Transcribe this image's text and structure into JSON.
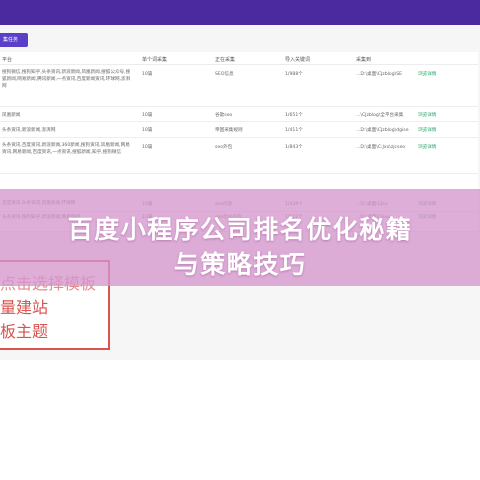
{
  "toolbar": {
    "task_button_label": "集任务"
  },
  "table": {
    "headers": {
      "platform": "平台",
      "single_count": "单个词采集",
      "collecting": "正在采集",
      "import_keywords": "导入关键词",
      "collect_to": "采集到"
    },
    "rows": [
      {
        "platform": "搜狗微信,搜狗知乎,头条资讯,新浪新闻,凤凰新闻,搜狐公众号,搜狐新闻,网易新闻,腾讯新闻,一点资讯,百度新闻资讯,环球网,澎湃网",
        "single_count": "10篇",
        "collecting": "SEO信息",
        "import_keywords": "1/988个",
        "collect_to": "...D:\\桌面\\CJzblog\\SE",
        "action": "浏览详情"
      },
      {
        "platform": "凤凰新闻",
        "single_count": "10篇",
        "collecting": "谷歌seo",
        "import_keywords": "1/651个",
        "collect_to": "...\\CJzblog\\全平台采集",
        "action": "浏览详情"
      },
      {
        "platform": "头条资讯,新浪新闻,澎湃网",
        "single_count": "10篇",
        "collecting": "帝国采集规则",
        "import_keywords": "1/411个",
        "collect_to": "...D:\\桌面\\CJzblog\\dgise",
        "action": "浏览详情"
      },
      {
        "platform": "头条资讯,百度资讯,新浪新闻,360新闻,搜狗资讯,凤凰新闻,网易资讯,网易新闻,百度资讯,一点资讯,搜狐新闻,知乎,搜狗微信",
        "single_count": "10篇",
        "collecting": "seo外包",
        "import_keywords": "1/843个",
        "collect_to": "...D:\\桌面\\C:Jxx\\zjcseo",
        "action": "浏览详情"
      },
      {
        "platform": "百度资讯,头条资讯,凤凰新闻,环球网",
        "single_count": "10篇",
        "collecting": "seo托管",
        "import_keywords": "1/439个",
        "collect_to": "...D:\\桌面\\CJxx",
        "action": "浏览详情"
      },
      {
        "platform": "头条资讯,搜狗知乎,新浪新闻,网易新闻",
        "single_count": "10篇",
        "collecting": "seo优化外包",
        "import_keywords": "1/622个",
        "collect_to": "...D:\\桌面\\CJseo",
        "action": "浏览详情"
      }
    ]
  },
  "overlay": {
    "title_line1": "百度小程序公司排名优化秘籍",
    "title_line2": "与策略技巧"
  },
  "template_box": {
    "line1": "点击选择模板",
    "line2": "量建站",
    "line3": "板主题"
  }
}
